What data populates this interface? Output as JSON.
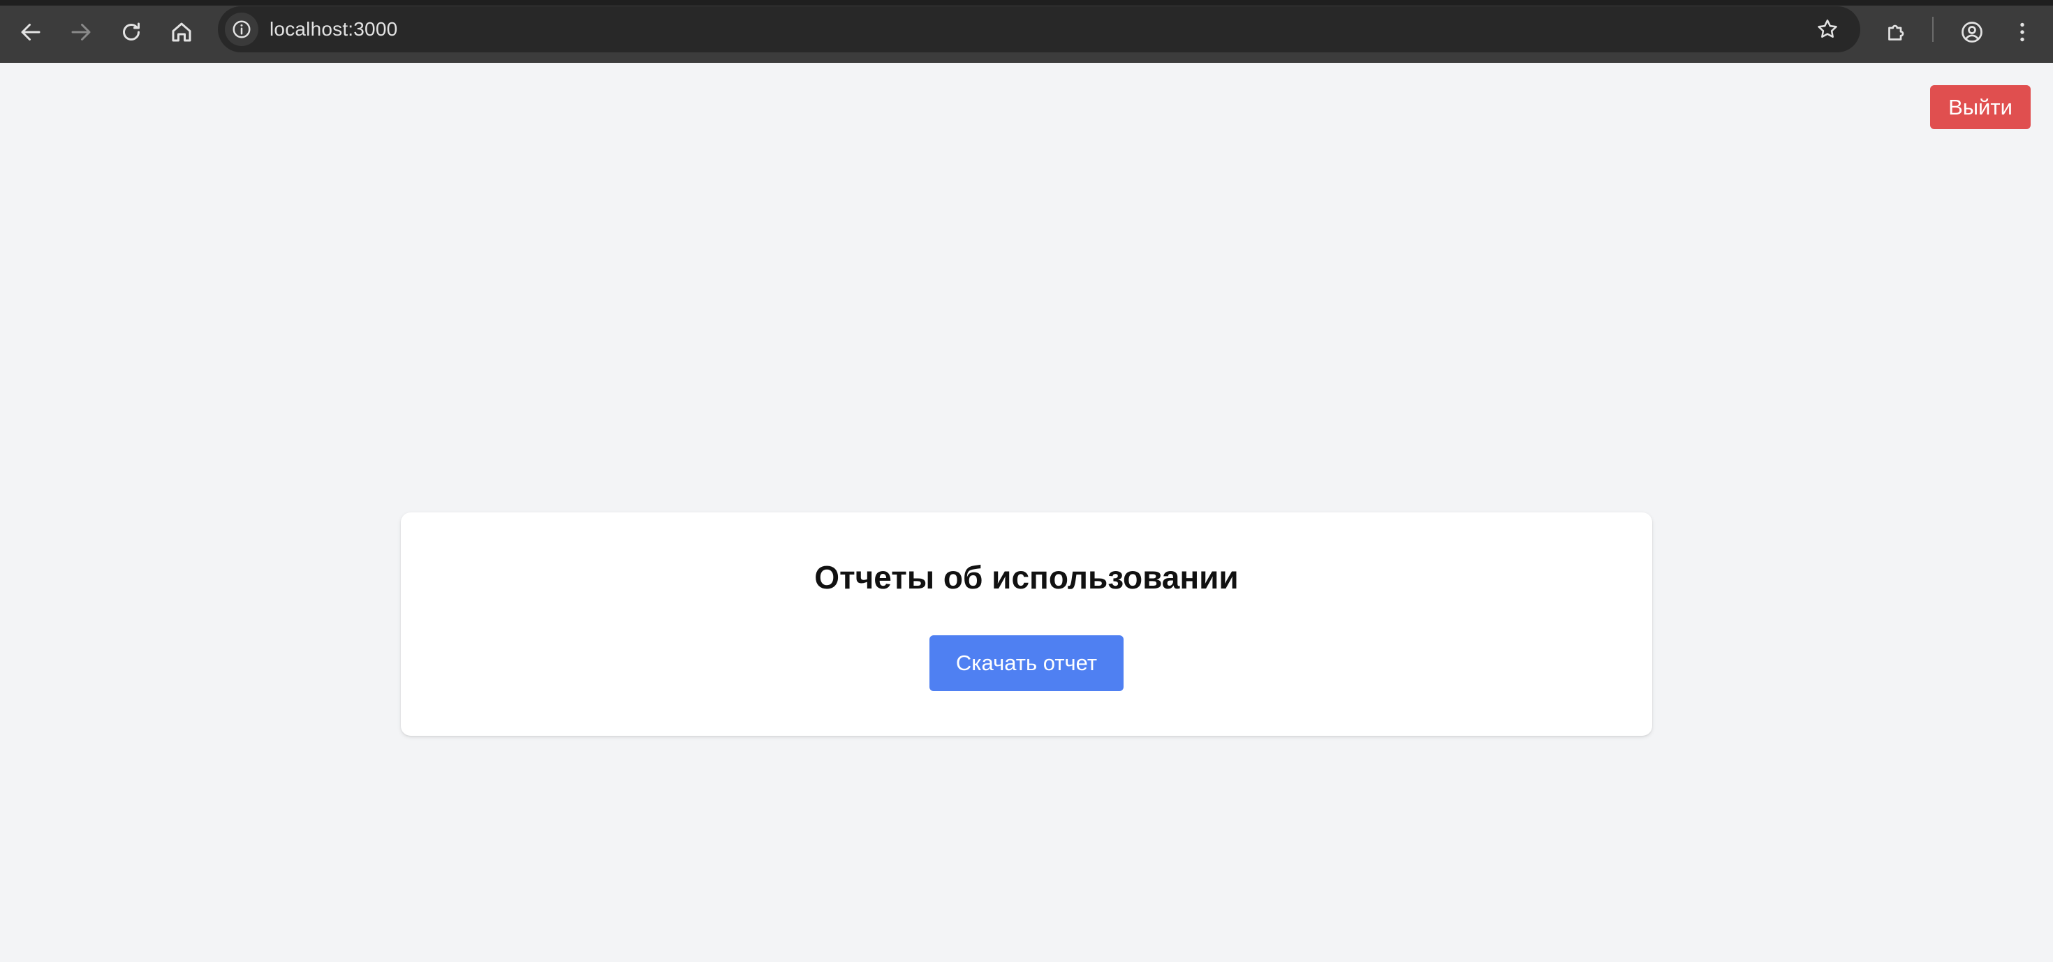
{
  "browser": {
    "url": "localhost:3000",
    "icons": {
      "back": "arrow-left-icon",
      "forward": "arrow-right-icon",
      "reload": "reload-icon",
      "home": "home-icon",
      "site_info": "info-icon",
      "bookmark": "star-icon",
      "extensions": "puzzle-icon",
      "profile": "account-icon",
      "menu": "more-vertical-icon"
    },
    "forward_enabled": false
  },
  "header": {
    "logout_label": "Выйти"
  },
  "reports": {
    "title": "Отчеты об использовании",
    "download_label": "Скачать отчет"
  },
  "colors": {
    "page_background": "#f3f4f6",
    "logout_button": "#e04f4f",
    "download_button": "#4f80f2",
    "card_background": "#ffffff"
  }
}
